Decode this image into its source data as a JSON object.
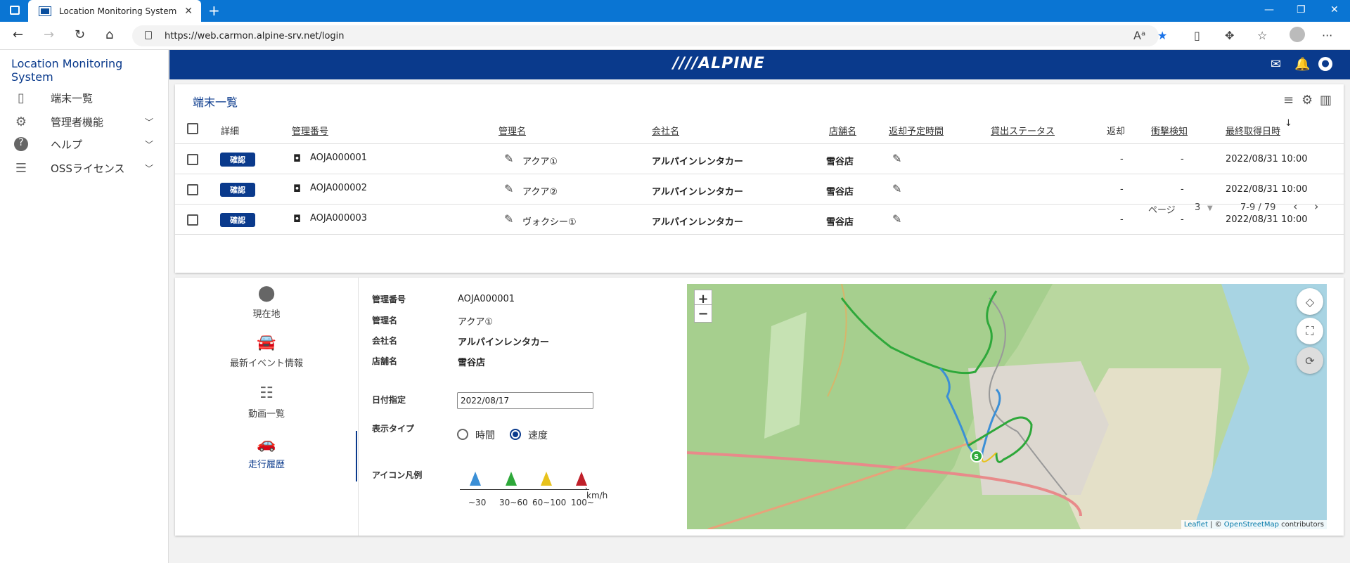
{
  "browser": {
    "tab_title": "Location Monitoring System",
    "url": "https://web.carmon.alpine-srv.net/login"
  },
  "sidebar": {
    "app_title": "Location Monitoring System",
    "items": [
      {
        "label": "端末一覧",
        "icon": "phone-icon"
      },
      {
        "label": "管理者機能",
        "icon": "gear-icon"
      },
      {
        "label": "ヘルプ",
        "icon": "help-icon"
      },
      {
        "label": "OSSライセンス",
        "icon": "list-icon"
      }
    ]
  },
  "header": {
    "logo": "////ALPINE"
  },
  "device_list": {
    "title": "端末一覧",
    "columns": [
      "詳細",
      "管理番号",
      "管理名",
      "会社名",
      "店舗名",
      "返却予定時間",
      "貸出ステータス",
      "返却",
      "衝撃検知",
      "最終取得日時"
    ],
    "confirm_label": "確認",
    "rows": [
      {
        "id": "AOJA000001",
        "name": "アクア①",
        "company": "アルパインレンタカー",
        "store": "雪谷店",
        "return": "-",
        "impact": "-",
        "last": "2022/08/31 10:00"
      },
      {
        "id": "AOJA000002",
        "name": "アクア②",
        "company": "アルパインレンタカー",
        "store": "雪谷店",
        "return": "-",
        "impact": "-",
        "last": "2022/08/31 10:00"
      },
      {
        "id": "AOJA000003",
        "name": "ヴォクシー①",
        "company": "アルパインレンタカー",
        "store": "雪谷店",
        "return": "-",
        "impact": "-",
        "last": "2022/08/31 10:00"
      }
    ],
    "pager": {
      "page_label": "ページ",
      "page": "3",
      "range": "7-9 / 79"
    }
  },
  "detail": {
    "tabs": [
      {
        "label": "現在地",
        "icon": "pin-icon"
      },
      {
        "label": "最新イベント情報",
        "icon": "car-event-icon"
      },
      {
        "label": "動画一覧",
        "icon": "video-list-icon"
      },
      {
        "label": "走行履歴",
        "icon": "car-icon"
      }
    ],
    "fields": {
      "id_label": "管理番号",
      "id_value": "AOJA000001",
      "name_label": "管理名",
      "name_value": "アクア①",
      "company_label": "会社名",
      "company_value": "アルパインレンタカー",
      "store_label": "店舗名",
      "store_value": "雪谷店",
      "date_label": "日付指定",
      "date_value": "2022/08/17",
      "display_label": "表示タイプ",
      "opt_time": "時間",
      "opt_speed": "速度",
      "legend_label": "アイコン凡例"
    },
    "legend": [
      {
        "label": "~30",
        "color": "#3b8fd6"
      },
      {
        "label": "30~60",
        "color": "#2ea83a"
      },
      {
        "label": "60~100",
        "color": "#e8c21c"
      },
      {
        "label": "100~",
        "color": "#c0202a"
      }
    ],
    "legend_unit": "km/h",
    "map_attrib": {
      "leaflet": "Leaflet",
      "sep": " | © ",
      "osm": "OpenStreetMap",
      "tail": " contributors"
    },
    "map_start": "S"
  }
}
